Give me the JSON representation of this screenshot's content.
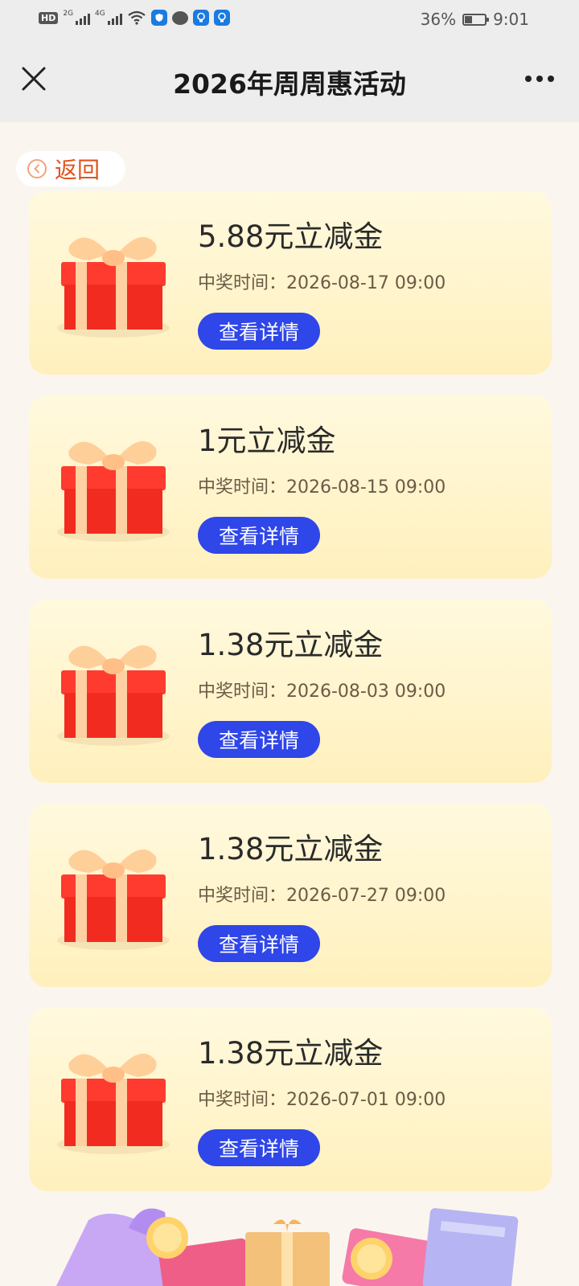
{
  "status_bar": {
    "hd": "HD",
    "sim1": "2G",
    "sim2": "4G",
    "battery": "36%",
    "time": "9:01"
  },
  "header": {
    "title": "2026年周周惠活动"
  },
  "back": {
    "label": "返回"
  },
  "prizes": [
    {
      "title": "5.88元立减金",
      "time": "中奖时间：2026-08-17 09:00",
      "button": "查看详情"
    },
    {
      "title": "1元立减金",
      "time": "中奖时间：2026-08-15 09:00",
      "button": "查看详情"
    },
    {
      "title": "1.38元立减金",
      "time": "中奖时间：2026-08-03 09:00",
      "button": "查看详情"
    },
    {
      "title": "1.38元立减金",
      "time": "中奖时间：2026-07-27 09:00",
      "button": "查看详情"
    },
    {
      "title": "1.38元立减金",
      "time": "中奖时间：2026-07-01 09:00",
      "button": "查看详情"
    }
  ],
  "icons": {
    "close": "close-icon",
    "more": "more-icon",
    "back": "chevron-left-icon",
    "gift": "gift-box-icon"
  },
  "colors": {
    "accent_button": "#2f46e8",
    "back_text": "#e0541f",
    "card_bg_top": "#fff9de",
    "card_bg_bottom": "#fff0bd",
    "page_bg": "#faf6ef"
  }
}
